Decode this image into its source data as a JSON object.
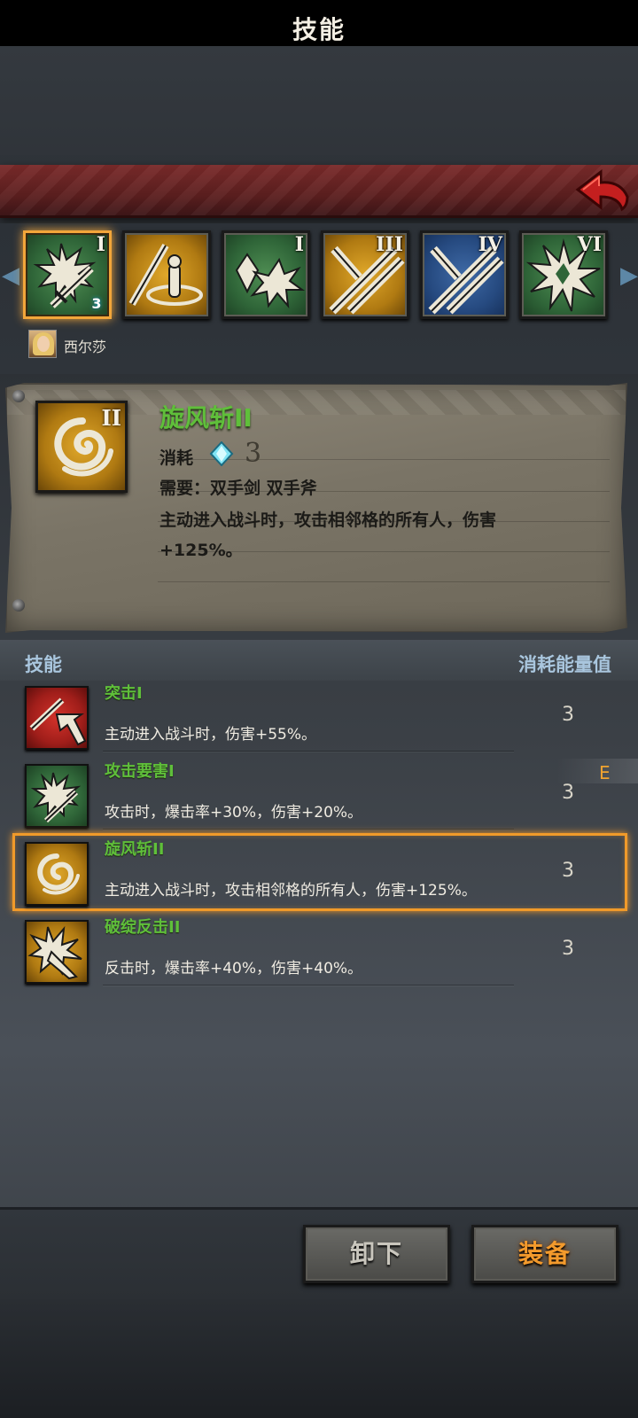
{
  "header": {
    "title": "技能"
  },
  "hero": {
    "name": "西尔莎"
  },
  "slots": [
    {
      "rank": "I",
      "bg": "green",
      "icon": "burst-sword-icon",
      "level": "3",
      "selected": true
    },
    {
      "rank": "",
      "bg": "gold",
      "icon": "sword-circle-icon",
      "level": "",
      "selected": false
    },
    {
      "rank": "I",
      "bg": "green",
      "icon": "crystal-burst-icon",
      "level": "",
      "selected": false
    },
    {
      "rank": "III",
      "bg": "gold",
      "icon": "crossed-swords-icon",
      "level": "",
      "selected": false
    },
    {
      "rank": "IV",
      "bg": "blue",
      "icon": "crossed-swords-icon",
      "level": "",
      "selected": false
    },
    {
      "rank": "VI",
      "bg": "green",
      "icon": "burst-icon",
      "level": "",
      "selected": false
    }
  ],
  "detail": {
    "rank": "II",
    "name": "旋风斩II",
    "cost_label": "消耗",
    "cost_value": "3",
    "requirement": "需要：双手剑  双手斧",
    "description": "主动进入战斗时，攻击相邻格的所有人，伤害+125%。"
  },
  "list": {
    "header_left": "技能",
    "header_right": "消耗能量值",
    "equipped_tag": "E",
    "rows": [
      {
        "name": "突击I",
        "desc": "主动进入战斗时，伤害+55%。",
        "cost": "3",
        "bg": "red",
        "icon": "sword-arrow-icon"
      },
      {
        "name": "攻击要害I",
        "desc": "攻击时，爆击率+30%，伤害+20%。",
        "cost": "3",
        "bg": "green",
        "icon": "burst-sword-icon"
      },
      {
        "name": "旋风斩II",
        "desc": "主动进入战斗时，攻击相邻格的所有人，伤害+125%。",
        "cost": "3",
        "bg": "gold",
        "icon": "whirlwind-icon"
      },
      {
        "name": "破绽反击II",
        "desc": "反击时，爆击率+40%，伤害+40%。",
        "cost": "3",
        "bg": "gold",
        "icon": "counter-burst-icon"
      }
    ]
  },
  "actions": {
    "unequip_label": "卸下",
    "equip_label": "装备"
  },
  "colors": {
    "skill_name": "#5fbf3a",
    "highlight": "#f09a2a",
    "header_text": "#a9c6de",
    "banner": "#7a2a2a"
  }
}
